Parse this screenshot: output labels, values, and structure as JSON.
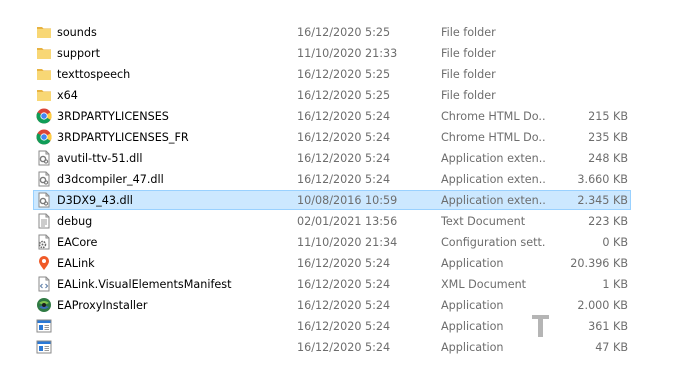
{
  "files": [
    {
      "name": "sounds",
      "date": "16/12/2020 5:25",
      "type": "File folder",
      "size": "",
      "icon": "folder-icon"
    },
    {
      "name": "support",
      "date": "11/10/2020 21:33",
      "type": "File folder",
      "size": "",
      "icon": "folder-icon"
    },
    {
      "name": "texttospeech",
      "date": "16/12/2020 5:25",
      "type": "File folder",
      "size": "",
      "icon": "folder-icon"
    },
    {
      "name": "x64",
      "date": "16/12/2020 5:25",
      "type": "File folder",
      "size": "",
      "icon": "folder-icon"
    },
    {
      "name": "3RDPARTYLICENSES",
      "date": "16/12/2020 5:24",
      "type": "Chrome HTML Do...",
      "size": "215 KB",
      "icon": "chrome-icon"
    },
    {
      "name": "3RDPARTYLICENSES_FR",
      "date": "16/12/2020 5:24",
      "type": "Chrome HTML Do...",
      "size": "235 KB",
      "icon": "chrome-icon"
    },
    {
      "name": "avutil-ttv-51.dll",
      "date": "16/12/2020 5:24",
      "type": "Application exten...",
      "size": "248 KB",
      "icon": "dll-icon"
    },
    {
      "name": "d3dcompiler_47.dll",
      "date": "16/12/2020 5:24",
      "type": "Application exten...",
      "size": "3.660 KB",
      "icon": "dll-icon"
    },
    {
      "name": "D3DX9_43.dll",
      "date": "10/08/2016 10:59",
      "type": "Application exten...",
      "size": "2.345 KB",
      "icon": "dll-icon",
      "selected": true
    },
    {
      "name": "debug",
      "date": "02/01/2021 13:56",
      "type": "Text Document",
      "size": "223 KB",
      "icon": "text-document-icon"
    },
    {
      "name": "EACore",
      "date": "11/10/2020 21:34",
      "type": "Configuration sett...",
      "size": "0 KB",
      "icon": "config-icon"
    },
    {
      "name": "EALink",
      "date": "16/12/2020 5:24",
      "type": "Application",
      "size": "20.396 KB",
      "icon": "ea-link-icon"
    },
    {
      "name": "EALink.VisualElementsManifest",
      "date": "16/12/2020 5:24",
      "type": "XML Document",
      "size": "1 KB",
      "icon": "xml-document-icon"
    },
    {
      "name": "EAProxyInstaller",
      "date": "16/12/2020 5:24",
      "type": "Application",
      "size": "2.000 KB",
      "icon": "installer-icon"
    },
    {
      "name": "",
      "date": "16/12/2020 5:24",
      "type": "Application",
      "size": "361 KB",
      "icon": "application-icon"
    },
    {
      "name": "",
      "date": "16/12/2020 5:24",
      "type": "Application",
      "size": "47 KB",
      "icon": "application-icon"
    }
  ],
  "watermark": {
    "text": "T",
    "icon": "text-cursor-watermark-icon"
  },
  "colors": {
    "selection_fill": "#cce8ff",
    "selection_border": "#99d1ff",
    "folder": "#f2c55c",
    "chrome_red": "#db4437",
    "chrome_green": "#0f9d58",
    "chrome_yellow": "#ffcd40",
    "chrome_blue": "#4285f4",
    "ea_orange": "#f05a28"
  }
}
